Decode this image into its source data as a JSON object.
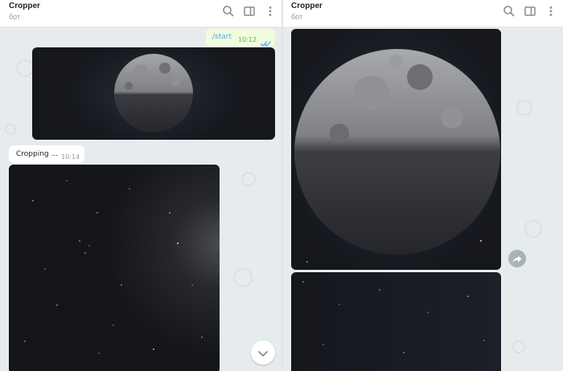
{
  "left_pane": {
    "header": {
      "title": "Cropper",
      "subtitle": "бот"
    },
    "messages": {
      "outgoing_text": "/start",
      "outgoing_time": "10:12",
      "incoming_text": "Cropping ...",
      "incoming_time": "10:14"
    }
  },
  "right_pane": {
    "header": {
      "title": "Cropper",
      "subtitle": "бот"
    }
  },
  "icons": {
    "search": "search-icon",
    "sidebar": "sidebar-toggle-icon",
    "menu": "more-vertical-icon",
    "scroll_down": "chevron-down-icon",
    "forward": "forward-icon",
    "read_receipt": "double-check-icon"
  },
  "colors": {
    "accent": "#4ea4f6",
    "chat_background": "#e6ebee",
    "outgoing_bubble": "#effdde",
    "incoming_bubble": "#ffffff",
    "time_text": "#8a8a8a",
    "night_sky": "#14161d"
  }
}
